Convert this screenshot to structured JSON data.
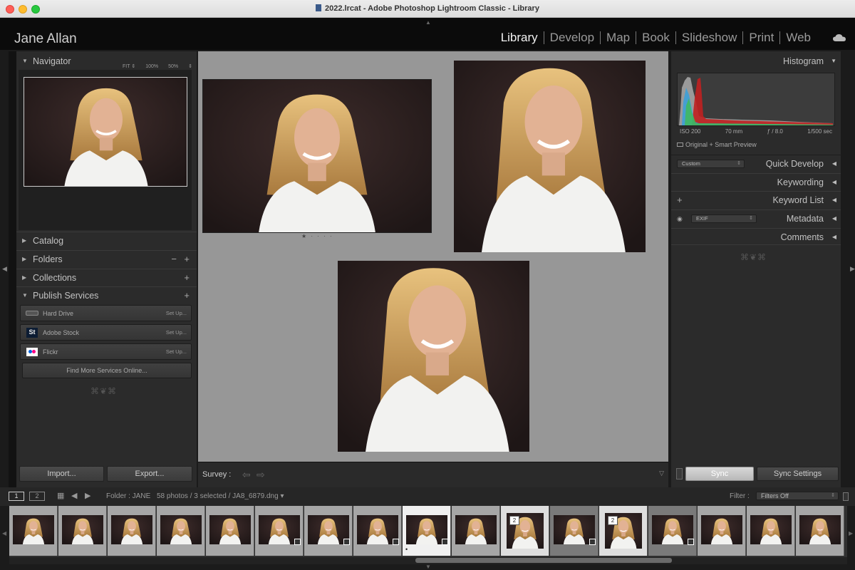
{
  "window": {
    "title": "2022.lrcat - Adobe Photoshop Lightroom Classic - Library"
  },
  "identity": {
    "name": "Jane Allan"
  },
  "modules": [
    "Library",
    "Develop",
    "Map",
    "Book",
    "Slideshow",
    "Print",
    "Web"
  ],
  "active_module": "Library",
  "navigator": {
    "title": "Navigator",
    "zoom": [
      "FIT ⇕",
      "100%",
      "50%",
      "⇕"
    ]
  },
  "left_panels": {
    "catalog": "Catalog",
    "folders": "Folders",
    "collections": "Collections",
    "publish_services": "Publish Services"
  },
  "publish_services": [
    {
      "name": "Hard Drive",
      "action": "Set Up...",
      "icon": "hard-drive-icon"
    },
    {
      "name": "Adobe Stock",
      "action": "Set Up...",
      "icon": "adobe-stock-icon",
      "icon_text": "St"
    },
    {
      "name": "Flickr",
      "action": "Set Up...",
      "icon": "flickr-icon"
    }
  ],
  "find_more": "Find More Services Online...",
  "import_label": "Import...",
  "export_label": "Export...",
  "toolbar": {
    "view_label": "Survey :"
  },
  "photo_rating": "★ · · · ·",
  "histogram": {
    "title": "Histogram",
    "iso": "ISO 200",
    "focal": "70 mm",
    "aperture": "ƒ / 8.0",
    "shutter": "1/500 sec",
    "preview": "Original + Smart Preview"
  },
  "right_panels": {
    "quick_develop": "Quick Develop",
    "quick_develop_preset": "Custom",
    "keywording": "Keywording",
    "keyword_list": "Keyword List",
    "metadata": "Metadata",
    "metadata_preset": "EXIF",
    "comments": "Comments"
  },
  "sync": {
    "sync_label": "Sync",
    "sync_settings_label": "Sync Settings"
  },
  "filmstrip_bar": {
    "screen1": "1",
    "screen2": "2",
    "folder": "Folder : JANE",
    "count": "58 photos / 3 selected / JA8_6879.dng ▾",
    "filter_label": "Filter :",
    "filter_value": "Filters Off"
  },
  "filmstrip": [
    {
      "state": "normal"
    },
    {
      "state": "normal"
    },
    {
      "state": "normal"
    },
    {
      "state": "normal"
    },
    {
      "state": "normal"
    },
    {
      "state": "normal",
      "badge_icon": true
    },
    {
      "state": "normal",
      "badge_icon": true
    },
    {
      "state": "normal",
      "badge_icon": true
    },
    {
      "state": "active",
      "badge_icon": true,
      "rating": "•"
    },
    {
      "state": "normal"
    },
    {
      "state": "selected",
      "stack": "2"
    },
    {
      "state": "dim",
      "badge_icon": true
    },
    {
      "state": "selected",
      "stack": "2"
    },
    {
      "state": "dim",
      "badge_icon": true
    },
    {
      "state": "normal"
    },
    {
      "state": "normal"
    },
    {
      "state": "normal"
    }
  ],
  "colors": {
    "accent": "#d0d0d0",
    "panel": "#2b2b2b",
    "center_bg": "#979797"
  }
}
